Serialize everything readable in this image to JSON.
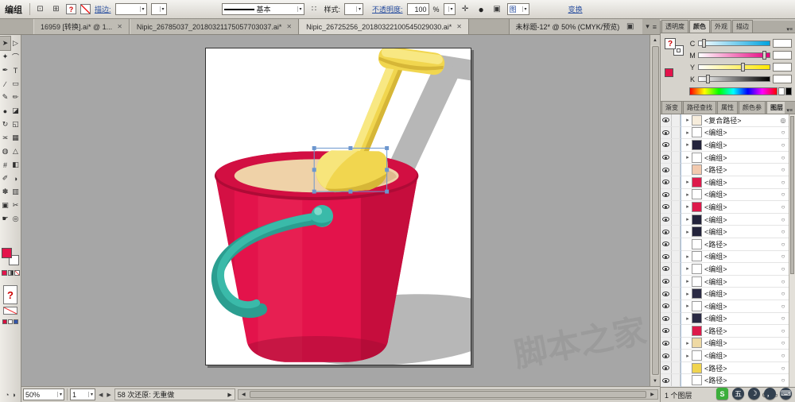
{
  "colors": {
    "bucket_red": "#E3134B",
    "bucket_red_dark": "#C60D3D",
    "bucket_red_deep": "#A00A33",
    "rim_red": "#D20F42",
    "rim_red_dark": "#AE0B36",
    "sand": "#EFD2A8",
    "sand_dark": "#DFBB8E",
    "teal": "#3ABAA9",
    "teal_dark": "#2B9E90",
    "teal_light": "#7EDACB",
    "yellow": "#F1D64F",
    "yellow_dark": "#D6B637",
    "yellow_light": "#F8E883",
    "shadow": "#B7B7B7",
    "selection_blue": "#6C96CE",
    "accent_link": "#2B50A0"
  },
  "control_bar": {
    "context_label": "编组",
    "fill_proxy": "?",
    "stroke_link": "描边:",
    "brush_name": "基本",
    "style_label": "样式:",
    "opacity_link": "不透明度:",
    "opacity_value": "100",
    "percent_label": "%",
    "doc_icon": "图",
    "transform_link": "变换"
  },
  "tab_bar": {
    "tabs": [
      {
        "label": "16959 [转换].ai* @ 1..."
      },
      {
        "label": "Nipic_26785037_20180321175057703037.ai*"
      },
      {
        "label": "Nipic_26725256_20180322100545029030.ai*"
      }
    ],
    "active_index": 2,
    "floating_doc_title": "未标题-12* @ 50% (CMYK/预览)"
  },
  "toolbox": {
    "tools": [
      {
        "name": "selection-tool",
        "glyph": "➤"
      },
      {
        "name": "direct-selection-tool",
        "glyph": "▷"
      },
      {
        "name": "magic-wand-tool",
        "glyph": "✦"
      },
      {
        "name": "lasso-tool",
        "glyph": "⌒"
      },
      {
        "name": "pen-tool",
        "glyph": "✒"
      },
      {
        "name": "type-tool",
        "glyph": "T"
      },
      {
        "name": "line-tool",
        "glyph": "∕"
      },
      {
        "name": "rectangle-tool",
        "glyph": "▭"
      },
      {
        "name": "paintbrush-tool",
        "glyph": "✎"
      },
      {
        "name": "pencil-tool",
        "glyph": "✏"
      },
      {
        "name": "blob-brush-tool",
        "glyph": "●"
      },
      {
        "name": "eraser-tool",
        "glyph": "◪"
      },
      {
        "name": "rotate-tool",
        "glyph": "↻"
      },
      {
        "name": "scale-tool",
        "glyph": "◱"
      },
      {
        "name": "width-tool",
        "glyph": "≍"
      },
      {
        "name": "free-transform-tool",
        "glyph": "▦"
      },
      {
        "name": "shape-builder-tool",
        "glyph": "◍"
      },
      {
        "name": "perspective-grid-tool",
        "glyph": "△"
      },
      {
        "name": "mesh-tool",
        "glyph": "#"
      },
      {
        "name": "gradient-tool",
        "glyph": "◧"
      },
      {
        "name": "eyedropper-tool",
        "glyph": "✐"
      },
      {
        "name": "blend-tool",
        "glyph": "◑"
      },
      {
        "name": "symbol-sprayer-tool",
        "glyph": "✽"
      },
      {
        "name": "column-graph-tool",
        "glyph": "▥"
      },
      {
        "name": "artboard-tool",
        "glyph": "▣"
      },
      {
        "name": "slice-tool",
        "glyph": "✂"
      },
      {
        "name": "hand-tool",
        "glyph": "☛"
      },
      {
        "name": "zoom-tool",
        "glyph": "◎"
      }
    ]
  },
  "color_panel": {
    "tabs": [
      "透明度",
      "颜色",
      "外观",
      "描边"
    ],
    "active_tab": "颜色",
    "channels": [
      {
        "label": "C",
        "key": "c",
        "value": "",
        "knob": 5
      },
      {
        "label": "M",
        "key": "m",
        "value": "",
        "knob": 90
      },
      {
        "label": "Y",
        "key": "y",
        "value": "",
        "knob": 60
      },
      {
        "label": "K",
        "key": "k",
        "value": "",
        "knob": 10
      }
    ]
  },
  "lower_panel": {
    "tabs": [
      "渐变",
      "路径查找",
      "属性",
      "颜色参",
      "图层"
    ],
    "active_tab": "图层"
  },
  "layers_panel": {
    "rows": [
      {
        "label": "<复合路径>",
        "thumb": "#F7EDDC",
        "target": "◎",
        "group": true
      },
      {
        "label": "<编组>",
        "thumb": "#FFFFFF",
        "target": "○",
        "group": true
      },
      {
        "label": "<编组>",
        "thumb": "#23233B",
        "target": "○",
        "group": true
      },
      {
        "label": "<编组>",
        "thumb": "#FFFFFF",
        "target": "○",
        "group": true
      },
      {
        "label": "<路径>",
        "thumb": "#F2C9AE",
        "target": "○",
        "group": false
      },
      {
        "label": "<编组>",
        "thumb": "#DD1A4B",
        "target": "○",
        "group": true
      },
      {
        "label": "<编组>",
        "thumb": "#FFFFFF",
        "target": "○",
        "group": true
      },
      {
        "label": "<编组>",
        "thumb": "#DD1A4B",
        "target": "○",
        "group": true
      },
      {
        "label": "<编组>",
        "thumb": "#23233B",
        "target": "○",
        "group": true
      },
      {
        "label": "<编组>",
        "thumb": "#23233B",
        "target": "○",
        "group": true
      },
      {
        "label": "<路径>",
        "thumb": "#FFFFFF",
        "target": "○",
        "group": false
      },
      {
        "label": "<编组>",
        "thumb": "#FFFFFF",
        "target": "○",
        "group": true
      },
      {
        "label": "<编组>",
        "thumb": "#FFFFFF",
        "target": "○",
        "group": true
      },
      {
        "label": "<编组>",
        "thumb": "#FFFFFF",
        "target": "○",
        "group": true
      },
      {
        "label": "<编组>",
        "thumb": "#2A2A44",
        "target": "○",
        "group": true
      },
      {
        "label": "<编组>",
        "thumb": "#FFFFFF",
        "target": "○",
        "group": true
      },
      {
        "label": "<编组>",
        "thumb": "#2A2A44",
        "target": "○",
        "group": true
      },
      {
        "label": "<路径>",
        "thumb": "#DD1A4B",
        "target": "○",
        "group": false
      },
      {
        "label": "<编组>",
        "thumb": "#EED9A4",
        "target": "○",
        "group": true
      },
      {
        "label": "<编组>",
        "thumb": "#FFFFFF",
        "target": "○",
        "group": true
      },
      {
        "label": "<路径>",
        "thumb": "#F0D44F",
        "target": "○",
        "group": false
      },
      {
        "label": "<路径>",
        "thumb": "#FFFFFF",
        "target": "○",
        "group": false
      }
    ],
    "footer_text": "1 个图层"
  },
  "status_bar": {
    "zoom_value": "50%",
    "artboard_value": "1",
    "history_text": "58 次还原: 无重做"
  },
  "ime_bar": {
    "items": [
      {
        "glyph": "S",
        "bg": "#3BAE3B",
        "shape": "square",
        "name": "ime-sogou-icon"
      },
      {
        "glyph": "五",
        "bg": "#33404F",
        "shape": "circle",
        "name": "ime-wubi-icon"
      },
      {
        "glyph": "☽",
        "bg": "#33404F",
        "shape": "circle",
        "name": "ime-halfwidth-icon"
      },
      {
        "glyph": "，",
        "bg": "#33404F",
        "shape": "circle",
        "name": "ime-punctuation-icon"
      },
      {
        "glyph": "⌨",
        "bg": "#33404F",
        "shape": "circle",
        "name": "ime-keyboard-icon"
      }
    ]
  },
  "watermark": "脚本之家"
}
